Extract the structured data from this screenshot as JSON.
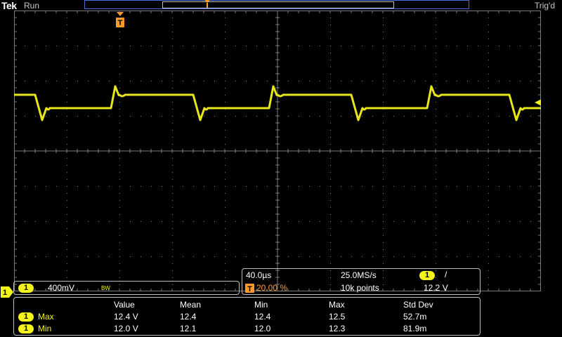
{
  "brand": "Tek",
  "status": {
    "run": "Run",
    "trigger": "Trig'd"
  },
  "channel_box": {
    "channel": "1",
    "scale": "400mV",
    "bw_flag": "BW"
  },
  "timebase": {
    "horizontal_scale": "40.0µs",
    "sample_rate": "25.0MS/s",
    "trigger_channel": "1",
    "trigger_slope": "/",
    "trigger_position": "20.00 %",
    "record_length": "10k points",
    "trigger_level": "12.2 V"
  },
  "measurements": {
    "headers": [
      "Value",
      "Mean",
      "Min",
      "Max",
      "Std Dev"
    ],
    "rows": [
      {
        "channel": "1",
        "label": "Max",
        "values": [
          "12.4 V",
          "12.4",
          "12.4",
          "12.5",
          "52.7m"
        ]
      },
      {
        "channel": "1",
        "label": "Min",
        "values": [
          "12.0 V",
          "12.1",
          "12.0",
          "12.3",
          "81.9m"
        ]
      }
    ]
  },
  "left_badge": "1",
  "trigger_marker": "T",
  "colors": {
    "trace": "#f2f21c",
    "trigger": "#ff9a2a",
    "grid": "#7a7a7a",
    "record_bar": "#4a6fd8"
  }
}
